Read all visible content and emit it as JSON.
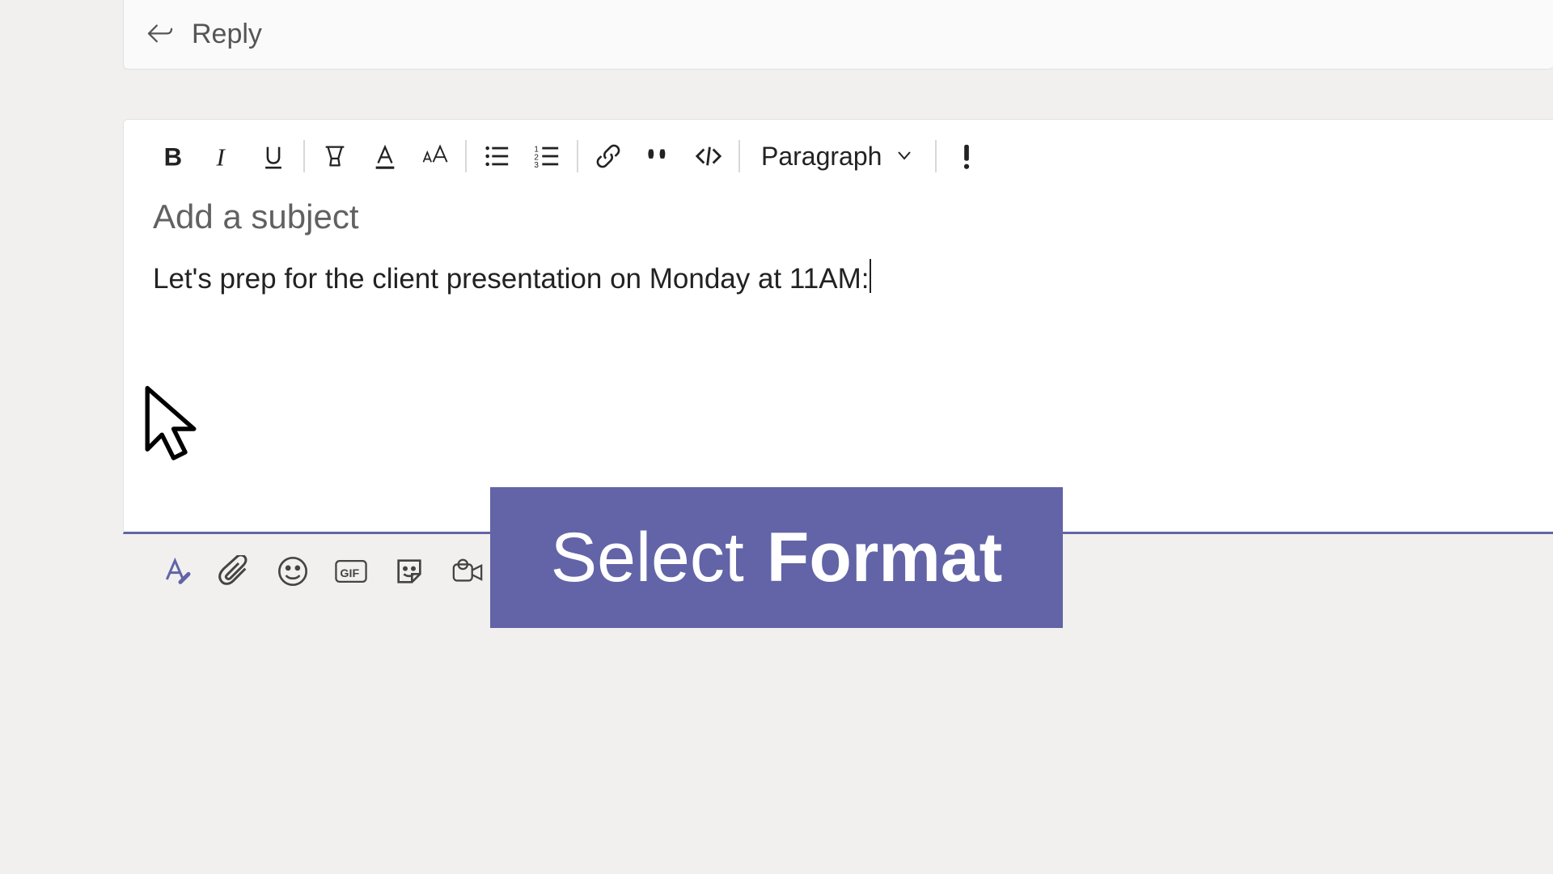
{
  "reply": {
    "label": "Reply"
  },
  "toolbar": {
    "bold": "Bold",
    "italic": "Italic",
    "underline": "Underline",
    "highlight": "Highlight",
    "font_color": "Font color",
    "font_size": "Font size",
    "bullet_list": "Bulleted list",
    "number_list": "Numbered list",
    "link": "Insert link",
    "quote": "Quote",
    "code": "Code snippet",
    "style_label": "Paragraph",
    "important": "Mark as important"
  },
  "composer": {
    "subject_placeholder": "Add a subject",
    "body_text": "Let's prep for the client presentation on Monday at 11AM:"
  },
  "bottom": {
    "format": "Format",
    "attach": "Attach",
    "emoji": "Emoji",
    "gif": "GIF",
    "sticker": "Sticker",
    "meet": "Meet now"
  },
  "callout": {
    "part1": "Select",
    "part2": "Format"
  }
}
